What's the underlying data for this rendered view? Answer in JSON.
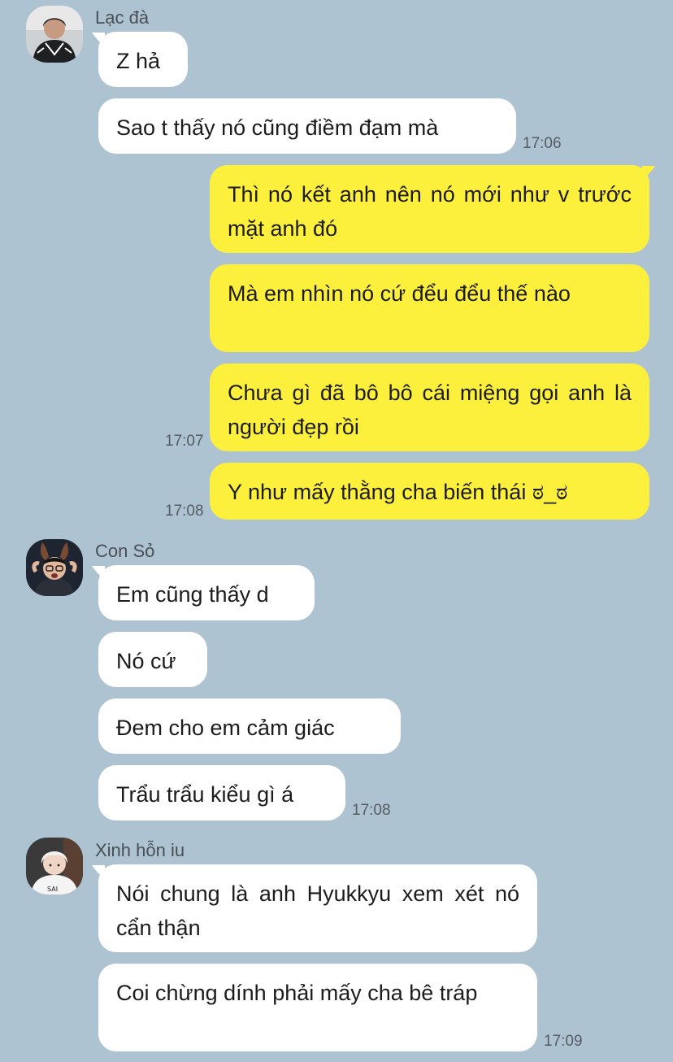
{
  "colors": {
    "background": "#aec3d2",
    "incoming_bubble": "#ffffff",
    "outgoing_bubble": "#fdf03c"
  },
  "groups": [
    {
      "sender": "Lạc đà",
      "avatar_icon": "user-avatar-dark-jacket",
      "messages": [
        "Z hả",
        "Sao t thấy nó cũng điềm đạm mà"
      ],
      "time": "17:06"
    },
    {
      "sender": "me",
      "messages": [
        "Thì nó kết anh nên nó mới như v trước mặt anh đó",
        "Mà em nhìn nó cứ đểu đểu thế nào",
        "Chưa gì đã bô bô cái miệng gọi anh là người đẹp rồi",
        "Y như mấy thằng cha biến thái ಠ_ಠ"
      ],
      "times": [
        "17:07",
        "17:08"
      ]
    },
    {
      "sender": "Con Sỏ",
      "avatar_icon": "user-avatar-bunny-ears",
      "messages": [
        "Em cũng thấy d",
        "Nó cứ",
        "Đem cho em cảm giác",
        "Trẩu trẩu kiểu gì á"
      ],
      "time": "17:08"
    },
    {
      "sender": "Xinh hỗn iu",
      "avatar_icon": "user-avatar-white-hair",
      "messages": [
        "Nói chung là anh Hyukkyu xem xét nó cẩn thận",
        "Coi chừng dính phải mấy cha bê tráp"
      ],
      "time": "17:09"
    }
  ]
}
